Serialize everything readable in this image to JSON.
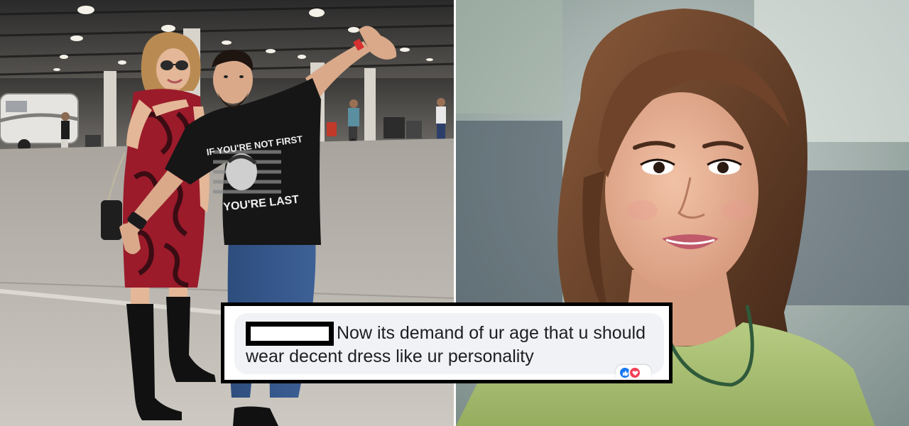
{
  "comment": {
    "author_redacted": true,
    "text": "Now its demand of ur age that u should wear decent dress like ur personality",
    "reaction_count": ""
  },
  "left_photo": {
    "tshirt_print_top": "IF YOU'RE NOT FIRST",
    "tshirt_print_bottom": "YOU'RE LAST"
  },
  "colors": {
    "comment_bubble": "#f0f2f5",
    "comment_text": "#1c1e21",
    "like_blue": "#1877f2",
    "love_red": "#f33e58",
    "dress_red": "#9b1b2a",
    "tshirt_black": "#161616",
    "blouse_green": "#a8c070"
  }
}
